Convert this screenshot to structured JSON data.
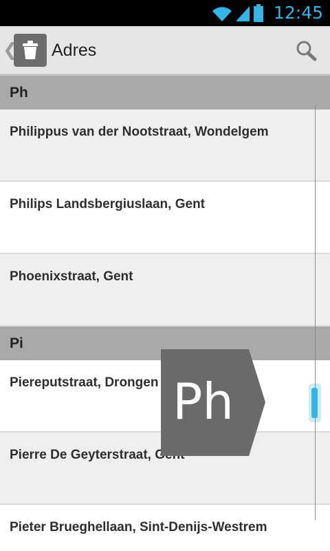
{
  "status_bar": {
    "time": "12:45",
    "icons": [
      "wifi-icon",
      "signal-icon",
      "battery-icon"
    ],
    "accent": "#33b5e5"
  },
  "action_bar": {
    "title": "Adres",
    "app_icon": "trash-icon",
    "search_icon": "search-icon",
    "up_glyph": "❮"
  },
  "list": {
    "sections": [
      {
        "header": "Ph",
        "items": [
          "Philippus van der Nootstraat, Wondelgem",
          "Philips Landsbergiuslaan, Gent",
          "Phoenixstraat, Gent"
        ]
      },
      {
        "header": "Pi",
        "items": [
          "Piereputstraat, Drongen",
          "Pierre De Geyterstraat, Gent",
          "Pieter Brueghellaan, Sint-Denijs-Westrem"
        ]
      }
    ]
  },
  "fast_scroll": {
    "preview_letter": "Ph",
    "thumb_color": "#33b5e5"
  }
}
